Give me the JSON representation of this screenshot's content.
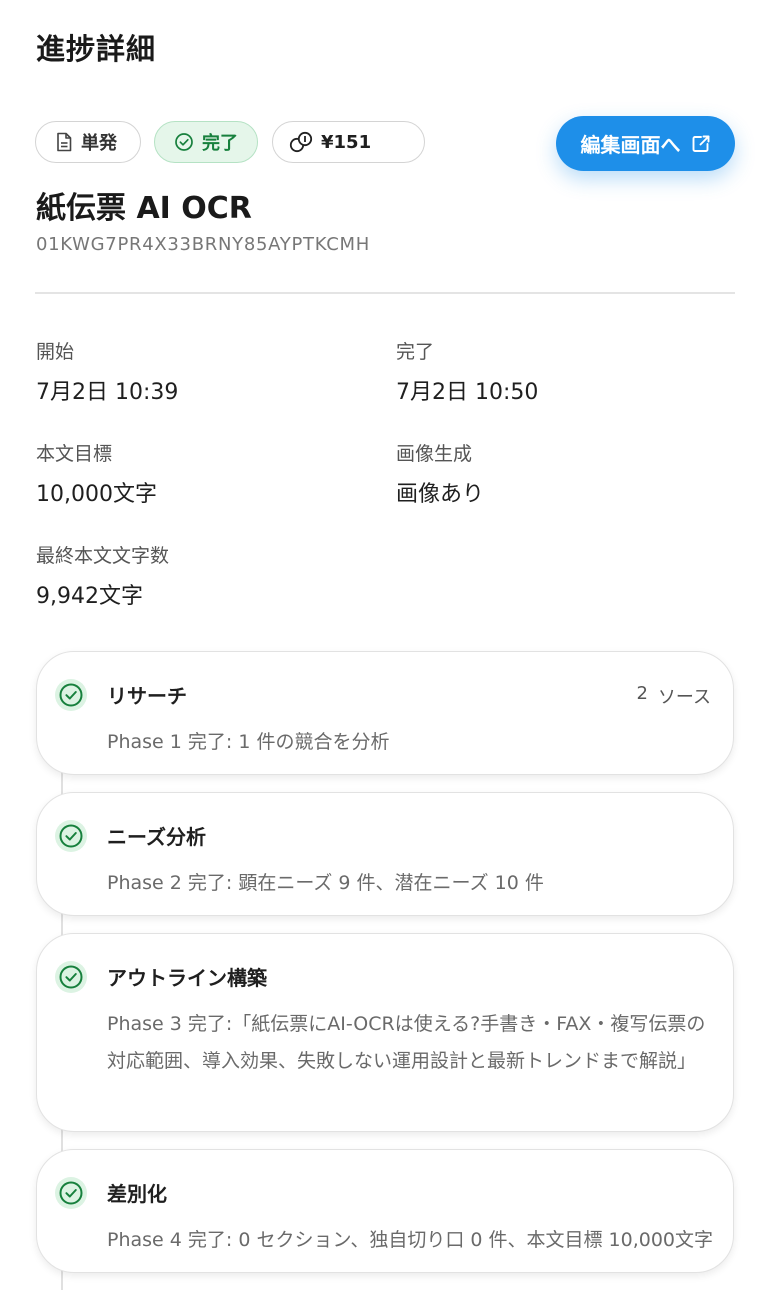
{
  "header": {
    "title": "進捗詳細"
  },
  "chips": {
    "type_label": "単発",
    "status_label": "完了",
    "cost_label": "¥151"
  },
  "edit_button": {
    "label": "編集画面へ"
  },
  "document": {
    "title": "紙伝票 AI OCR",
    "id": "01KWG7PR4X33BRNY85AYPTKCMH"
  },
  "details": {
    "start_label": "開始",
    "start_value": "7月2日 10:39",
    "end_label": "完了",
    "end_value": "7月2日 10:50",
    "target_label": "本文目標",
    "target_value": "10,000文字",
    "image_label": "画像生成",
    "image_value": "画像あり",
    "final_label": "最終本文文字数",
    "final_value": "9,942文字"
  },
  "phases": [
    {
      "title": "リサーチ",
      "meta_count": "2",
      "meta_unit": "ソース",
      "description": "Phase 1 完了: 1 件の競合を分析"
    },
    {
      "title": "ニーズ分析",
      "description": "Phase 2 完了: 顕在ニーズ 9 件、潜在ニーズ 10 件"
    },
    {
      "title": "アウトライン構築",
      "description": "Phase 3 完了:「紙伝票にAI-OCRは使える?手書き・FAX・複写伝票の対応範囲、導入効果、失敗しない運用設計と最新トレンドまで解説」"
    },
    {
      "title": "差別化",
      "description": "Phase 4 完了: 0 セクション、独自切り口 0 件、本文目標 10,000文字"
    }
  ],
  "colors": {
    "accent": "#1e8fe9",
    "success": "#17803d",
    "success_bg": "#e5f6ea"
  },
  "icons": {
    "type": "document-icon",
    "status": "check-circle-icon",
    "cost": "coins-icon",
    "edit": "external-link-icon",
    "phase": "check-circle-icon"
  }
}
